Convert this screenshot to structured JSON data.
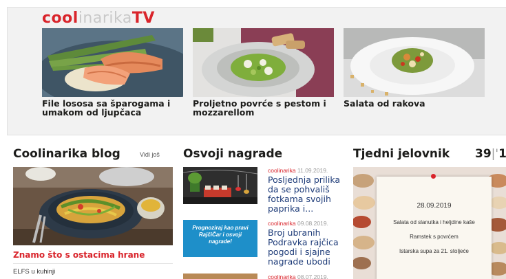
{
  "tv": {
    "logo_part1": "cool",
    "logo_part2": "inarika",
    "logo_part3": "TV",
    "cards": [
      {
        "title": "File lososa sa šparogama i umakom od ljupčaca"
      },
      {
        "title": "Proljetno povrće s pestom i mozzarellom"
      },
      {
        "title": "Salata od rakova"
      }
    ]
  },
  "blog": {
    "title": "Coolinarika blog",
    "more_link": "Vidi još",
    "headline": "Znamo što s ostacima hrane",
    "author": "ELFS u kuhinji"
  },
  "osvoji": {
    "title": "Osvoji nagrade",
    "items": [
      {
        "source": "coolinarika",
        "date": "11.09.2019.",
        "title": "Posljednja prilika da se pohvališ fotkama svojih paprika i..."
      },
      {
        "source": "coolinarika",
        "date": "09.08.2019.",
        "title": "Broj ubranih Podravka rajčica pogodi i sjajne nagrade ubodi",
        "banner": "Prognoziraj kao pravi RajčiČar i osvoji nagrade!"
      },
      {
        "source": "coolinarika",
        "date": "08.07.2019.",
        "title": ""
      }
    ]
  },
  "tjedni": {
    "title": "Tjedni jelovnik",
    "week_number": "39",
    "week_next": "1",
    "date": "28.09.2019",
    "dishes": [
      "Salata od slanutka i heljdine kaše",
      "Ramstek s povrćem",
      "Istarska supa za 21. stoljeće"
    ]
  },
  "colors": {
    "brand_red": "#d9242b",
    "link_blue": "#1d3b78",
    "strip_bg": "#f2f2f2"
  }
}
